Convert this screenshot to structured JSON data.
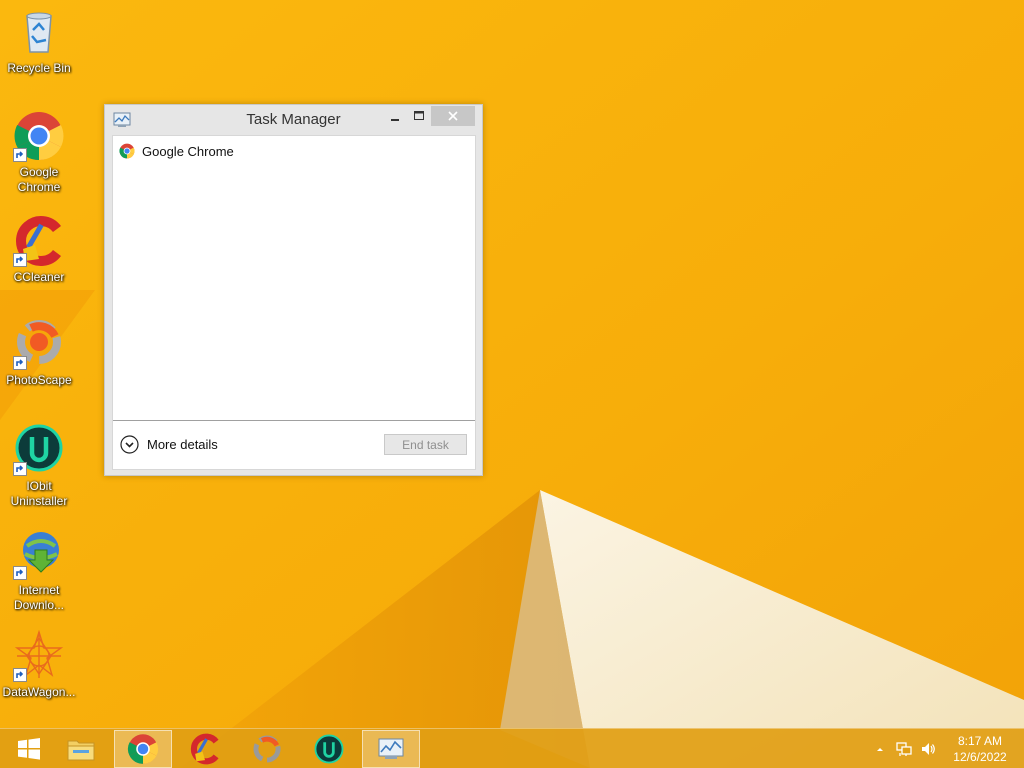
{
  "desktop": {
    "icons": [
      {
        "label_lines": [
          "Recycle Bin"
        ],
        "icon": "recycle-bin-icon",
        "shortcut": false
      },
      {
        "label_lines": [
          "Google",
          "Chrome"
        ],
        "icon": "chrome-icon",
        "shortcut": true
      },
      {
        "label_lines": [
          "CCleaner"
        ],
        "icon": "ccleaner-icon",
        "shortcut": true
      },
      {
        "label_lines": [
          "PhotoScape"
        ],
        "icon": "photoscape-icon",
        "shortcut": true
      },
      {
        "label_lines": [
          "IObit",
          "Uninstaller"
        ],
        "icon": "iobit-uninstaller-icon",
        "shortcut": true
      },
      {
        "label_lines": [
          "Internet",
          "Downlo..."
        ],
        "icon": "internet-download-manager-icon",
        "shortcut": true
      },
      {
        "label_lines": [
          "DataWagon..."
        ],
        "icon": "datawagon-icon",
        "shortcut": true
      }
    ]
  },
  "task_manager": {
    "title": "Task Manager",
    "processes": [
      {
        "name": "Google Chrome",
        "icon": "chrome-icon"
      }
    ],
    "more_details_label": "More details",
    "end_task_label": "End task",
    "end_task_enabled": false
  },
  "taskbar": {
    "buttons": [
      {
        "name": "start-button",
        "icon": "windows-logo-icon",
        "active": false
      },
      {
        "name": "file-explorer",
        "icon": "folder-icon",
        "active": false
      },
      {
        "name": "google-chrome",
        "icon": "chrome-icon",
        "active": true
      },
      {
        "name": "ccleaner",
        "icon": "ccleaner-icon",
        "active": false
      },
      {
        "name": "photoscape",
        "icon": "photoscape-icon",
        "active": false
      },
      {
        "name": "iobit-uninstaller",
        "icon": "iobit-uninstaller-icon",
        "active": false
      },
      {
        "name": "task-manager",
        "icon": "task-manager-icon",
        "active": true
      }
    ],
    "tray_icons": [
      "chevron-up-icon",
      "network-icon",
      "volume-icon"
    ],
    "clock": {
      "time": "8:17 AM",
      "date": "12/6/2022"
    }
  },
  "colors": {
    "wallpaper": "#f7b10c",
    "taskbar": "#e19e14",
    "window_chrome": "#e6e6e6"
  }
}
